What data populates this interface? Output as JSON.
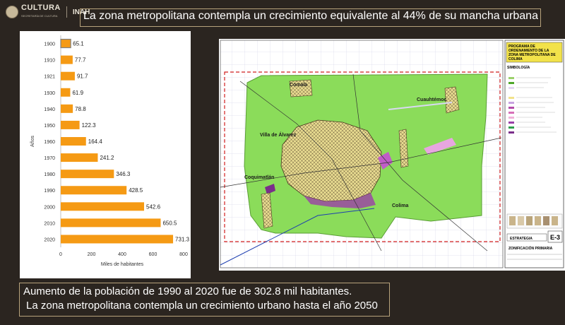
{
  "header": {
    "brand": "CULTURA",
    "brand_sub": "SECRETARÍA DE CULTURA",
    "inah": "INAH",
    "title": "La zona metropolitana contempla un crecimiento equivalente al 44% de su mancha urbana"
  },
  "chart_data": {
    "type": "bar",
    "orientation": "horizontal",
    "categories": [
      "1900",
      "1910",
      "1921",
      "1930",
      "1940",
      "1950",
      "1960",
      "1970",
      "1980",
      "1990",
      "2000",
      "2010",
      "2020"
    ],
    "values": [
      65.1,
      77.7,
      91.7,
      61.9,
      78.8,
      122.3,
      164.4,
      241.2,
      346.3,
      428.5,
      542.6,
      650.5,
      731.3
    ],
    "value_labels": [
      "65.1",
      "77.7",
      "91.7",
      "61.9",
      "78.8",
      "122.3",
      "164.4",
      "241.2",
      "346.3",
      "428.5",
      "542.6",
      "650.5",
      "731.3"
    ],
    "xlabel": "Miles de habitantes",
    "ylabel": "Años",
    "xlim": [
      0,
      800
    ],
    "xticks": [
      "0",
      "200",
      "400",
      "600",
      "800"
    ],
    "bar_color": "#f59a14",
    "highlight_color": "#7f7f7f",
    "highlight_index": 0
  },
  "map": {
    "legend_title": "PROGRAMA DE ORDENAMIENTO DE LA ZONA METROPOLITANA DE COLIMA",
    "legend_heading": "SIMBOLOGÍA",
    "sheet_code": "E-3",
    "sheet_label": "ESTRATEGIA",
    "sheet_subtitle": "ZONIFICACIÓN PRIMARIA",
    "places": [
      "Comala",
      "Cuauhtémoc",
      "Villa de Álvarez",
      "Coquimatlán",
      "Colima"
    ]
  },
  "footer": {
    "line1": "Aumento de la población de 1990 al 2020 fue de 302.8 mil habitantes.",
    "line2": "La zona metropolitana contempla un crecimiento urbano hasta el año 2050"
  },
  "colors": {
    "background": "#2b2520",
    "frame": "#b8a37c",
    "map_green": "#8bdc5a",
    "boundary": "#d11e1e"
  }
}
